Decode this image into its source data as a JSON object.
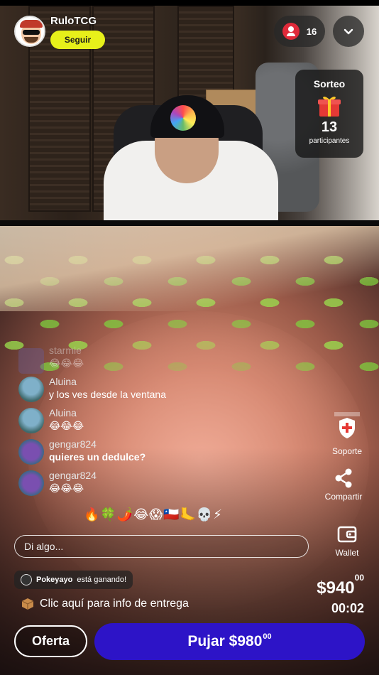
{
  "stream": {
    "username": "RuloTCG",
    "follow_label": "Seguir",
    "viewer_count": "16"
  },
  "giveaway": {
    "title": "Sorteo",
    "count": "13",
    "label": "participantes"
  },
  "chat": [
    {
      "user": "starmie",
      "text": "😂😂😂"
    },
    {
      "user": "Aluina",
      "text": "y los ves desde la ventana"
    },
    {
      "user": "Aluina",
      "text": "😂😂😂"
    },
    {
      "user": "gengar824",
      "text": "quieres un dedulce?"
    },
    {
      "user": "gengar824",
      "text": "😂😂😂"
    }
  ],
  "reactions": "🔥🍀🌶️😂😱🇨🇱🦶💀⚡",
  "input": {
    "placeholder": "Di algo..."
  },
  "actions": {
    "support": "Soporte",
    "share": "Compartir",
    "wallet": "Wallet"
  },
  "auction": {
    "winner_name": "Pokeyayo",
    "winner_suffix": "está ganando!",
    "delivery_text": "Clic aquí para info de entrega",
    "price_main": "$940",
    "price_cents": "00",
    "timer": "00:02",
    "offer_label": "Oferta",
    "bid_main": "Pujar $980",
    "bid_cents": "00"
  },
  "colors": {
    "follow_bg": "#e7f01a",
    "bid_bg": "#2d14c7",
    "viewer_dot": "#e02a3a"
  }
}
